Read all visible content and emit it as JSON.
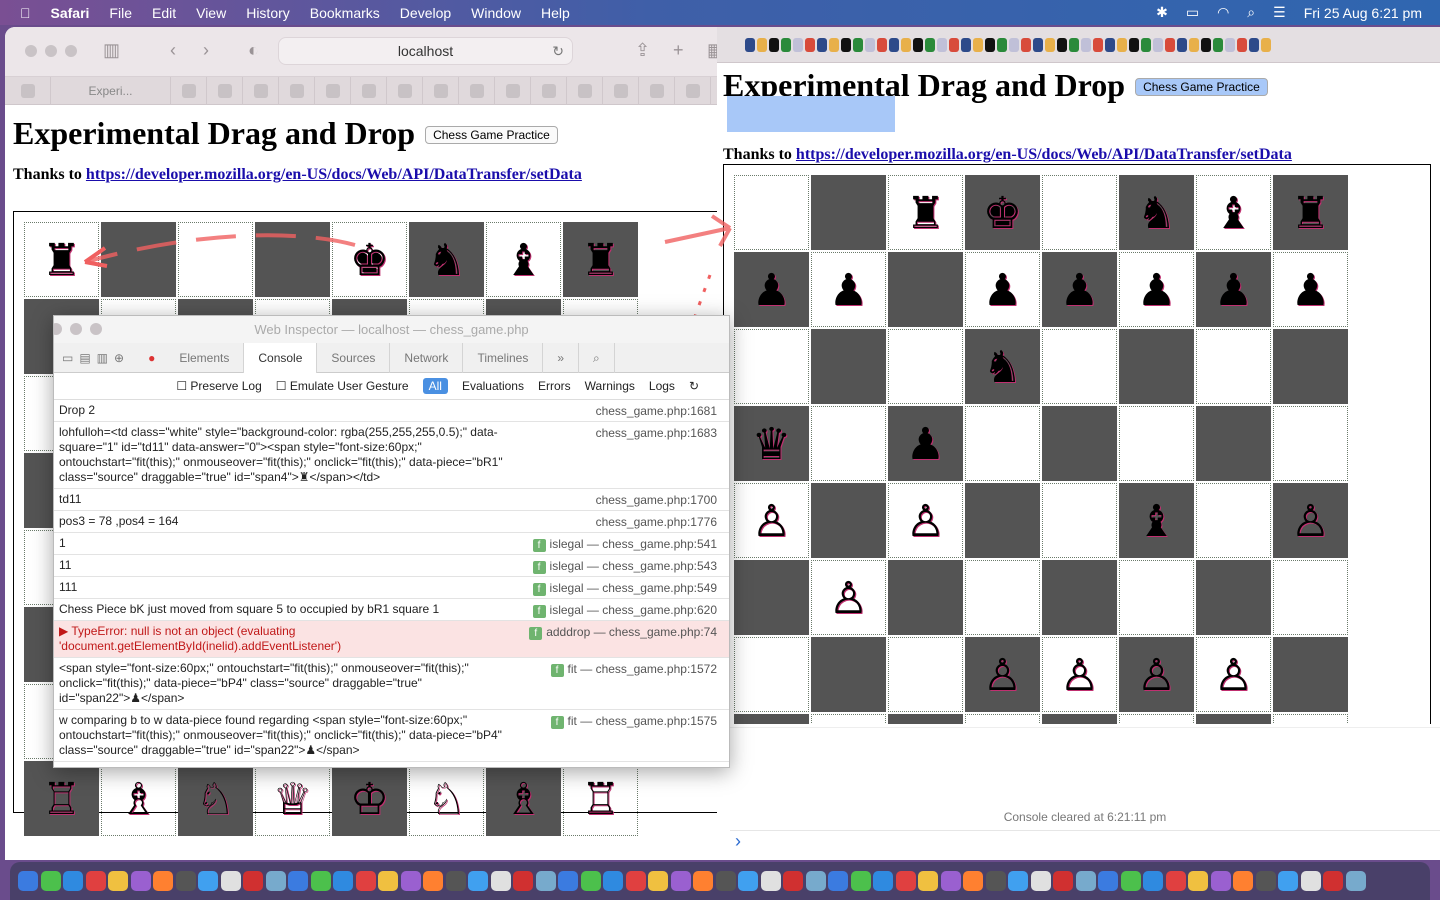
{
  "menubar": {
    "app": "Safari",
    "items": [
      "File",
      "Edit",
      "View",
      "History",
      "Bookmarks",
      "Develop",
      "Window",
      "Help"
    ],
    "clock": "Fri 25 Aug  6:21 pm"
  },
  "left": {
    "url": "localhost",
    "active_tab": "Experi...",
    "title": "Experimental Drag and Drop",
    "button": "Chess Game Practice",
    "thanks": "Thanks to",
    "link": "https://developer.mozilla.org/en-US/docs/Web/API/DataTransfer/setData",
    "board": [
      [
        "♜",
        "",
        "",
        "",
        "♚",
        "♞",
        "♝",
        "♜"
      ],
      [
        "",
        "",
        "",
        "",
        "",
        "",
        "",
        ""
      ],
      [
        "",
        "",
        "",
        "",
        "",
        "",
        "",
        ""
      ],
      [
        "",
        "",
        "",
        "",
        "",
        "",
        "",
        ""
      ],
      [
        "",
        "",
        "",
        "",
        "",
        "",
        "",
        ""
      ],
      [
        "",
        "",
        "",
        "",
        "",
        "",
        "",
        ""
      ],
      [
        "",
        "",
        "",
        "",
        "",
        "",
        "",
        ""
      ],
      [
        "♖",
        "♗",
        "♘",
        "♕",
        "♔",
        "♘",
        "♗",
        "♖"
      ]
    ]
  },
  "right": {
    "title": "Experimental Drag and Drop",
    "button": "Chess Game Practice",
    "thanks": "Thanks to",
    "link": "https://developer.mozilla.org/en-US/docs/Web/API/DataTransfer/setData",
    "console_cleared": "Console cleared at 6:21:11 pm",
    "prompt": "›",
    "board": [
      [
        "",
        "",
        "♜",
        "♚",
        "",
        "♞",
        "♝",
        "♜"
      ],
      [
        "♟",
        "♟",
        "",
        "♟",
        "♟",
        "♟",
        "♟",
        "♟"
      ],
      [
        "",
        "",
        "",
        "♞",
        "",
        "",
        "",
        ""
      ],
      [
        "♛",
        "",
        "♟",
        "",
        "",
        "",
        "",
        ""
      ],
      [
        "♙",
        "",
        "♙",
        "",
        "",
        "♝",
        "",
        "♙"
      ],
      [
        "",
        "♙",
        "",
        "",
        "",
        "",
        "",
        ""
      ],
      [
        "",
        "",
        "",
        "♙",
        "♙",
        "♙",
        "♙",
        ""
      ],
      [
        "",
        "",
        "",
        "",
        "",
        "",
        "",
        ""
      ]
    ]
  },
  "inspector": {
    "title": "Web Inspector — localhost — chess_game.php",
    "tabs": [
      "Elements",
      "Console",
      "Sources",
      "Network",
      "Timelines"
    ],
    "active_tab": "Console",
    "filters": {
      "preserve_log": "Preserve Log",
      "emulate": "Emulate User Gesture",
      "levels": [
        "All",
        "Evaluations",
        "Errors",
        "Warnings",
        "Logs"
      ]
    },
    "rows": [
      {
        "msg": "Drop 2",
        "fn": "",
        "src": "chess_game.php:1681"
      },
      {
        "msg": "lohfulloh=<td class=\"white\" style=\"background-color: rgba(255,255,255,0.5);\" data-square=\"1\" id=\"td11\" data-answer=\"0\"><span style=\"font-size:60px;\" ontouchstart=\"fit(this);\" onmouseover=\"fit(this);\" onclick=\"fit(this);\" data-piece=\"bR1\" class=\"source\" draggable=\"true\" id=\"span4\">♜</span></td>",
        "fn": "",
        "src": "chess_game.php:1683"
      },
      {
        "msg": "td11",
        "fn": "",
        "src": "chess_game.php:1700"
      },
      {
        "msg": "pos3 = 78 ,pos4 = 164",
        "fn": "",
        "src": "chess_game.php:1776"
      },
      {
        "msg": "1",
        "fn": "islegal",
        "src": "chess_game.php:541"
      },
      {
        "msg": "11",
        "fn": "islegal",
        "src": "chess_game.php:543"
      },
      {
        "msg": "111",
        "fn": "islegal",
        "src": "chess_game.php:549"
      },
      {
        "msg": "Chess Piece bK just moved from square 5 to occupied by bR1 square 1",
        "fn": "islegal",
        "src": "chess_game.php:620"
      },
      {
        "msg": "▶ TypeError: null is not an object (evaluating 'document.getElementById(inelid).addEventListener')",
        "fn": "adddrop",
        "src": "chess_game.php:74",
        "error": true
      },
      {
        "msg": "<span style=\"font-size:60px;\" ontouchstart=\"fit(this);\" onmouseover=\"fit(this);\" onclick=\"fit(this);\" data-piece=\"bP4\" class=\"source\" draggable=\"true\" id=\"span22\">♟</span>",
        "fn": "fit",
        "src": "chess_game.php:1572"
      },
      {
        "msg": "w comparing b to w data-piece found regarding <span style=\"font-size:60px;\" ontouchstart=\"fit(this);\" onmouseover=\"fit(this);\" onclick=\"fit(this);\" data-piece=\"bP4\" class=\"source\" draggable=\"true\" id=\"span22\">♟</span>",
        "fn": "fit",
        "src": "chess_game.php:1575"
      }
    ]
  },
  "colors": {
    "dark_square": "#545454",
    "error_bg": "#fbe3e3",
    "annotation": "#f06060",
    "selection": "#a8c8f8"
  }
}
